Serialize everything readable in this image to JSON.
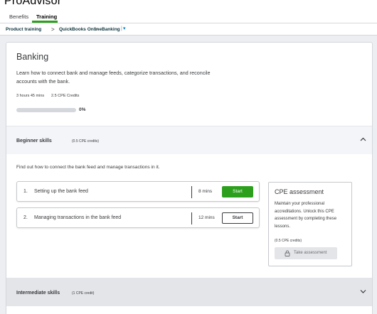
{
  "app": {
    "brand": "ProAdvisor"
  },
  "tabs": [
    {
      "label": "Benefits",
      "active": false
    },
    {
      "label": "Training",
      "active": true
    }
  ],
  "breadcrumb": {
    "items": [
      "Product training",
      "QuickBooks Online",
      "Banking"
    ],
    "separator": ">",
    "dropdown_icon": "caret-down-icon"
  },
  "course": {
    "title": "Banking",
    "description": "Learn how to connect bank and manage feeds, categorize transactions, and reconcile accounts with the bank.",
    "duration": "3 hours 45 mins",
    "credits": "2.5 CPE Credits",
    "progress_percent": 0,
    "progress_label": "0%"
  },
  "sections": {
    "beginner": {
      "title": "Beginner skills",
      "credits": "(0.5 CPE credits)",
      "expanded": true,
      "description": "Find out how to connect the bank feed and manage transactions in it.",
      "lessons": [
        {
          "number": "1.",
          "name": "Setting up the bank feed",
          "duration": "8 mins",
          "action": "Start"
        },
        {
          "number": "2.",
          "name": "Managing transactions in the bank feed",
          "duration": "12 mins",
          "action": "Start"
        }
      ]
    },
    "intermediate": {
      "title": "Intermediate skills",
      "credits": "(1 CPE credit)",
      "expanded": false
    }
  },
  "cpe_assessment": {
    "title": "CPE assessment",
    "text": "Maintain your professional accreditations. Unlock this CPE assessment by completing these lessons.",
    "credits": "(0.5 CPE credits)",
    "button_label": "Take assessment",
    "button_icon": "lock-icon"
  },
  "colors": {
    "accent_green": "#2ca01c",
    "text": "#393a3d",
    "link_blue": "#0077c5"
  }
}
